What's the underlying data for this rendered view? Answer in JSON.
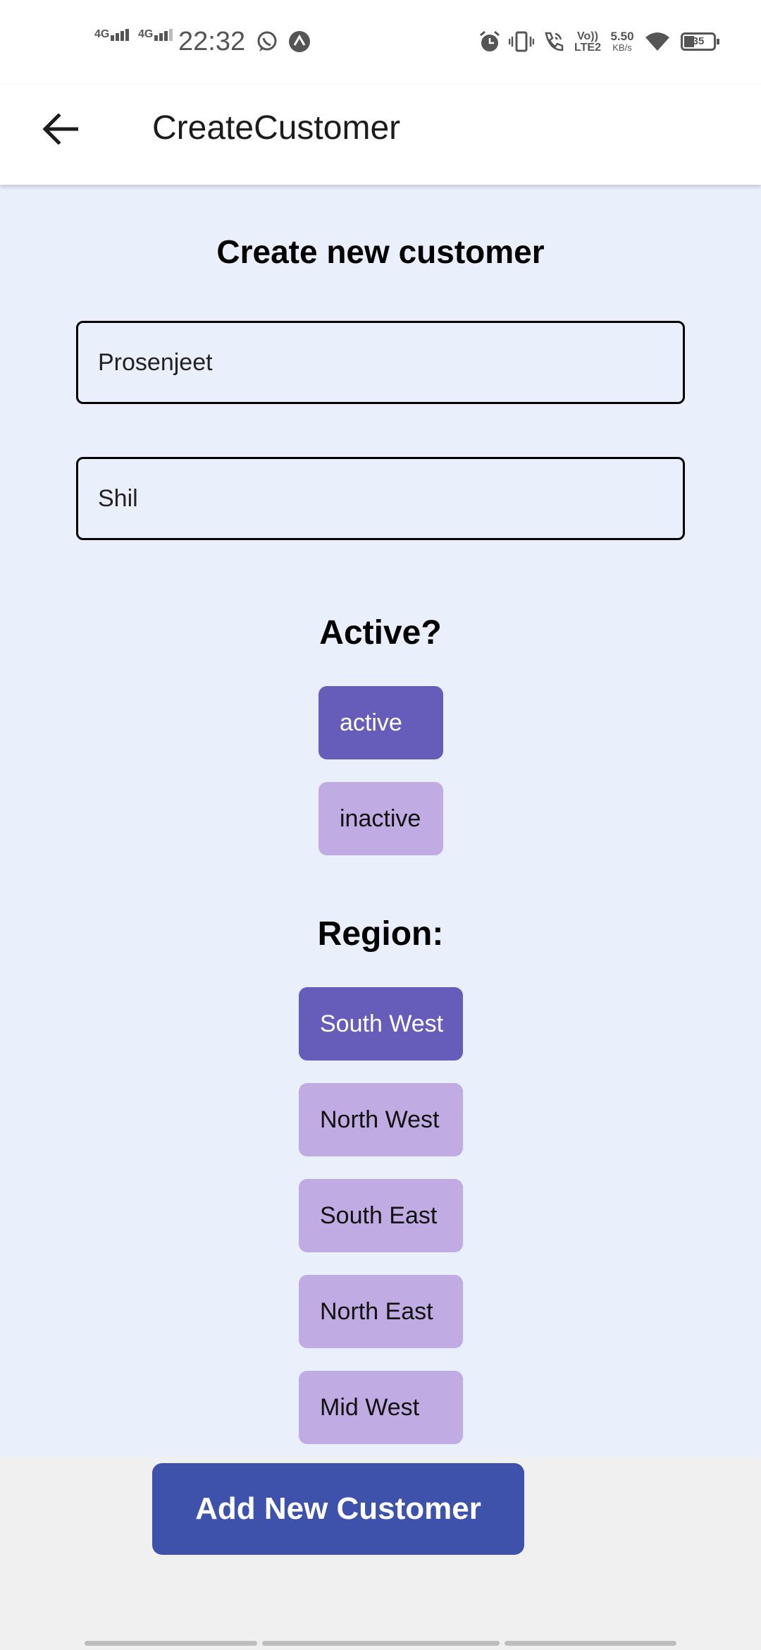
{
  "status_bar": {
    "network_1": "4G",
    "network_2": "4G",
    "time": "22:32",
    "icons": [
      "whatsapp-icon",
      "app-notification-icon",
      "alarm-icon",
      "vibrate-icon",
      "wifi-calling-icon",
      "wifi-icon",
      "battery-icon"
    ],
    "volte_top": "Vo))",
    "volte_bottom": "LTE2",
    "speed_value": "5.50",
    "speed_unit": "KB/s",
    "battery": "35"
  },
  "app_bar": {
    "title": "CreateCustomer",
    "back_icon": "arrow-left-icon"
  },
  "form": {
    "heading": "Create new customer",
    "first_name": "Prosenjeet",
    "last_name": "Shil"
  },
  "active_section": {
    "heading": "Active?",
    "options": [
      "active",
      "inactive"
    ],
    "selected": "active"
  },
  "region_section": {
    "heading": "Region:",
    "options": [
      "South West",
      "North West",
      "South East",
      "North East",
      "Mid West"
    ],
    "selected": "South West"
  },
  "submit_button": "Add New Customer",
  "colors": {
    "content_background": "#eaeffc",
    "chip_selected": "#665dbb",
    "chip_unselected": "#c0ace2",
    "primary_button": "#3e52ac"
  }
}
